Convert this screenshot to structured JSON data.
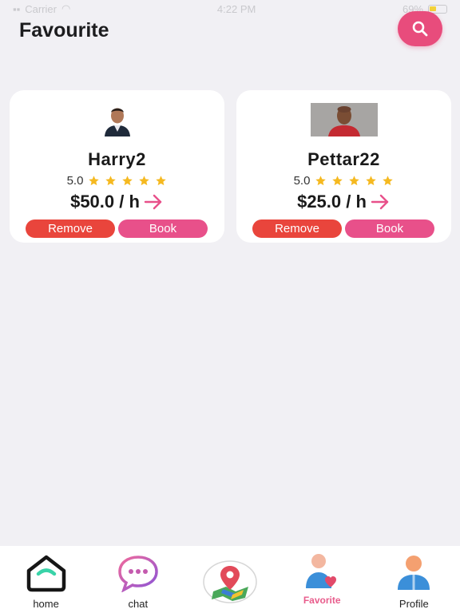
{
  "status_bar": {
    "carrier": "Carrier",
    "time": "4:22 PM",
    "battery": "69%"
  },
  "header": {
    "title": "Favourite",
    "search_icon": "search-icon",
    "accent": "#e84c7c"
  },
  "favorites": [
    {
      "name": "Harry2",
      "rating": "5.0",
      "stars": 5,
      "price": "$50.0 / h",
      "remove_label": "Remove",
      "book_label": "Book"
    },
    {
      "name": "Pettar22",
      "rating": "5.0",
      "stars": 5,
      "price": "$25.0 / h",
      "remove_label": "Remove",
      "book_label": "Book"
    }
  ],
  "tabs": [
    {
      "label": "home",
      "icon": "home-icon"
    },
    {
      "label": "chat",
      "icon": "chat-icon"
    },
    {
      "label": "",
      "icon": "map-pin-icon"
    },
    {
      "label": "Favorite",
      "icon": "favorite-icon",
      "active": true
    },
    {
      "label": "Profile",
      "icon": "profile-icon"
    }
  ],
  "colors": {
    "remove": "#e9453c",
    "book": "#e8508a",
    "star": "#f5b920",
    "active_tab": "#e85c8c"
  }
}
